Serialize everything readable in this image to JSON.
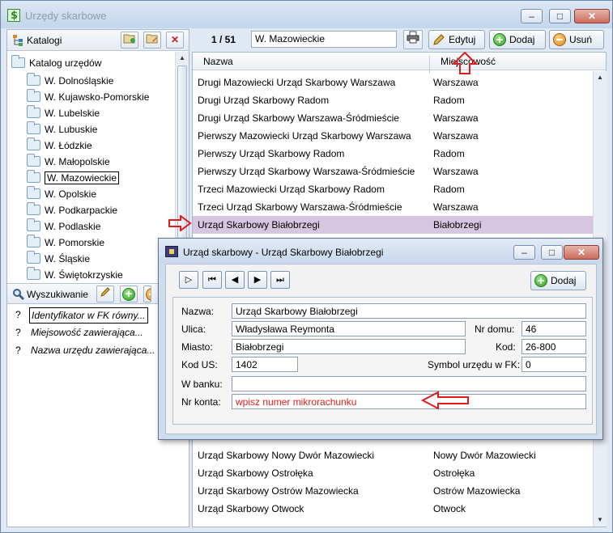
{
  "window": {
    "title": "Urzędy skarbowe",
    "minimize": "–",
    "maximize": "□",
    "close": "✕"
  },
  "catalogs": {
    "header": "Katalogi",
    "root": "Katalog urzędów",
    "items": [
      "W. Dolnośląskie",
      "W. Kujawsko-Pomorskie",
      "W. Lubelskie",
      "W. Lubuskie",
      "W. Łódzkie",
      "W. Małopolskie",
      "W. Mazowieckie",
      "W. Opolskie",
      "W. Podkarpackie",
      "W. Podlaskie",
      "W. Pomorskie",
      "W. Śląskie",
      "W. Świętokrzyskie"
    ],
    "selected": "W. Mazowieckie"
  },
  "search": {
    "header": "Wyszukiwanie",
    "criteria": [
      {
        "mark": "?",
        "text": "Identyfikator w FK równy..."
      },
      {
        "mark": "?",
        "text": "Miejsowość zawierająca..."
      },
      {
        "mark": "?",
        "text": "Nazwa urzędu zawierająca..."
      }
    ]
  },
  "toolbar": {
    "counter": "1 / 51",
    "search_value": "W. Mazowieckie",
    "edit_label": "Edytuj",
    "add_label": "Dodaj",
    "delete_label": "Usuń"
  },
  "grid": {
    "columns": [
      "Nazwa",
      "Miejscowość"
    ],
    "rows_top": [
      [
        "Drugi Mazowiecki Urząd Skarbowy Warszawa",
        "Warszawa"
      ],
      [
        "Drugi Urząd Skarbowy Radom",
        "Radom"
      ],
      [
        "Drugi Urząd Skarbowy Warszawa-Śródmieście",
        "Warszawa"
      ],
      [
        "Pierwszy Mazowiecki Urząd Skarbowy Warszawa",
        "Warszawa"
      ],
      [
        "Pierwszy Urząd Skarbowy Radom",
        "Radom"
      ],
      [
        "Pierwszy Urząd Skarbowy Warszawa-Śródmieście",
        "Warszawa"
      ],
      [
        "Trzeci Mazowiecki Urząd Skarbowy Radom",
        "Radom"
      ],
      [
        "Trzeci Urząd Skarbowy Warszawa-Śródmieście",
        "Warszawa"
      ],
      [
        "Urząd Skarbowy Białobrzegi",
        "Białobrzegi"
      ]
    ],
    "rows_bottom": [
      [
        "Urząd Skarbowy Nowy Dwór Mazowiecki",
        "Nowy Dwór Mazowiecki"
      ],
      [
        "Urząd Skarbowy Ostrołęka",
        "Ostrołęka"
      ],
      [
        "Urząd Skarbowy Ostrów Mazowiecka",
        "Ostrów Mazowiecka"
      ],
      [
        "Urząd Skarbowy Otwock",
        "Otwock"
      ]
    ]
  },
  "dialog": {
    "title": "Urząd skarbowy - Urząd Skarbowy Białobrzegi",
    "add_label": "Dodaj",
    "labels": {
      "nazwa": "Nazwa:",
      "ulica": "Ulica:",
      "nr_domu": "Nr domu:",
      "miasto": "Miasto:",
      "kod": "Kod:",
      "kod_us": "Kod US:",
      "symbol": "Symbol urzędu w FK:",
      "bank": "W banku:",
      "nr_konta": "Nr konta:"
    },
    "values": {
      "nazwa": "Urząd Skarbowy Białobrzegi",
      "ulica": "Władysława Reymonta",
      "nr_domu": "46",
      "miasto": "Białobrzegi",
      "kod": "26-800",
      "kod_us": "1402",
      "symbol": "0",
      "bank": "",
      "nr_konta": "wpisz numer mikrorachunku"
    }
  },
  "colors": {
    "annotation_red": "#e01b1b",
    "selected_row": "#d6c6e2"
  }
}
